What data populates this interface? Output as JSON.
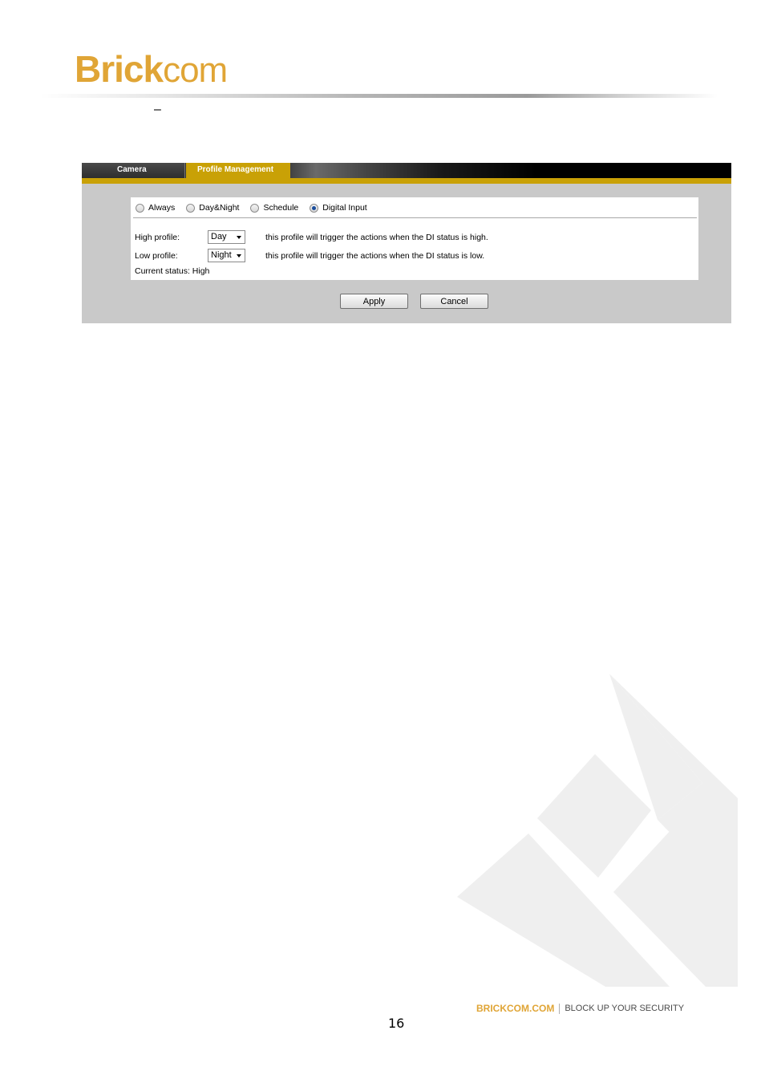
{
  "header": {
    "logo_brick": "Brick",
    "logo_com": "com",
    "dash": "–"
  },
  "tabs": [
    {
      "label": "Camera",
      "active": false
    },
    {
      "label": "Profile Management",
      "active": true
    }
  ],
  "modes": {
    "options": [
      "Always",
      "Day&Night",
      "Schedule",
      "Digital Input"
    ],
    "selected": "Digital Input"
  },
  "high_profile": {
    "label": "High profile:",
    "value": "Day",
    "description": "this profile will trigger the actions when the DI status is high."
  },
  "low_profile": {
    "label": "Low profile:",
    "value": "Night",
    "description": "this profile will trigger the actions when the DI status is low."
  },
  "status": {
    "text": "Current status: High"
  },
  "buttons": {
    "apply": "Apply",
    "cancel": "Cancel"
  },
  "footer": {
    "site": "BRICKCOM.COM",
    "tagline": "BLOCK UP YOUR SECURITY",
    "page_number": "16"
  },
  "colors": {
    "brand_gold": "#e0a536",
    "tab_gold": "#c9a106",
    "radio_checked": "#1a4d9c"
  }
}
